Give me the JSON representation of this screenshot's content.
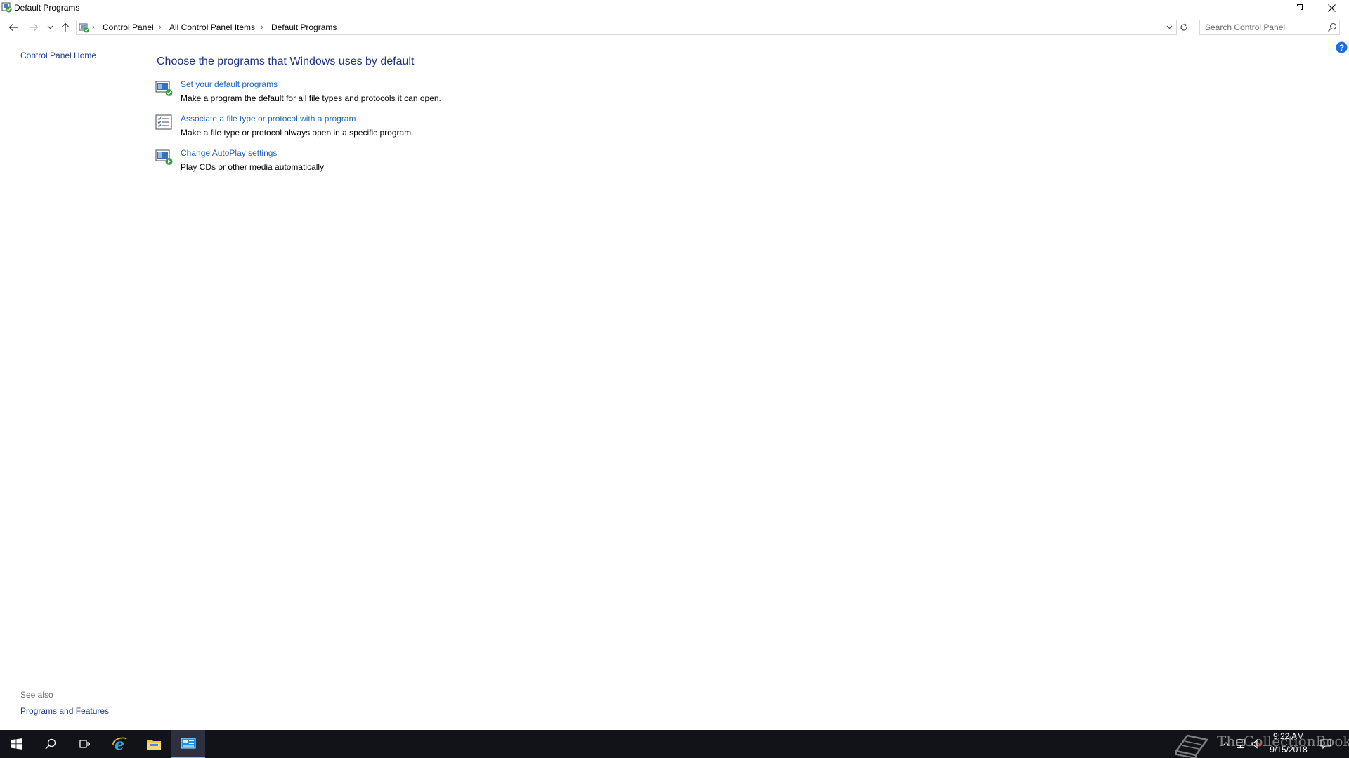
{
  "window": {
    "title": "Default Programs",
    "controls": {
      "minimize": "minimize",
      "restore": "restore",
      "close": "close"
    }
  },
  "address_bar": {
    "breadcrumbs": [
      "Control Panel",
      "All Control Panel Items",
      "Default Programs"
    ],
    "search_placeholder": "Search Control Panel"
  },
  "left_pane": {
    "home_link": "Control Panel Home",
    "see_also_heading": "See also",
    "see_also_links": [
      "Programs and Features"
    ]
  },
  "main": {
    "title": "Choose the programs that Windows uses by default",
    "tasks": [
      {
        "icon": "default-programs-icon",
        "link": "Set your default programs",
        "description": "Make a program the default for all file types and protocols it can open."
      },
      {
        "icon": "file-association-icon",
        "link": "Associate a file type or protocol with a program",
        "description": "Make a file type or protocol always open in a specific program."
      },
      {
        "icon": "autoplay-icon",
        "link": "Change AutoPlay settings",
        "description": "Play CDs or other media automatically"
      }
    ]
  },
  "taskbar": {
    "apps": [
      "start",
      "search",
      "task-view",
      "internet-explorer",
      "file-explorer",
      "control-panel"
    ],
    "active_app": "control-panel",
    "watermark": "TheCollectionBook",
    "clock": {
      "time": "9:22 AM",
      "date": "9/15/2018"
    }
  },
  "colors": {
    "link": "#1e64c8",
    "heading": "#1e3287",
    "nav_link": "#1e3c8c",
    "taskbar": "#111318",
    "accent": "#0078d7"
  }
}
